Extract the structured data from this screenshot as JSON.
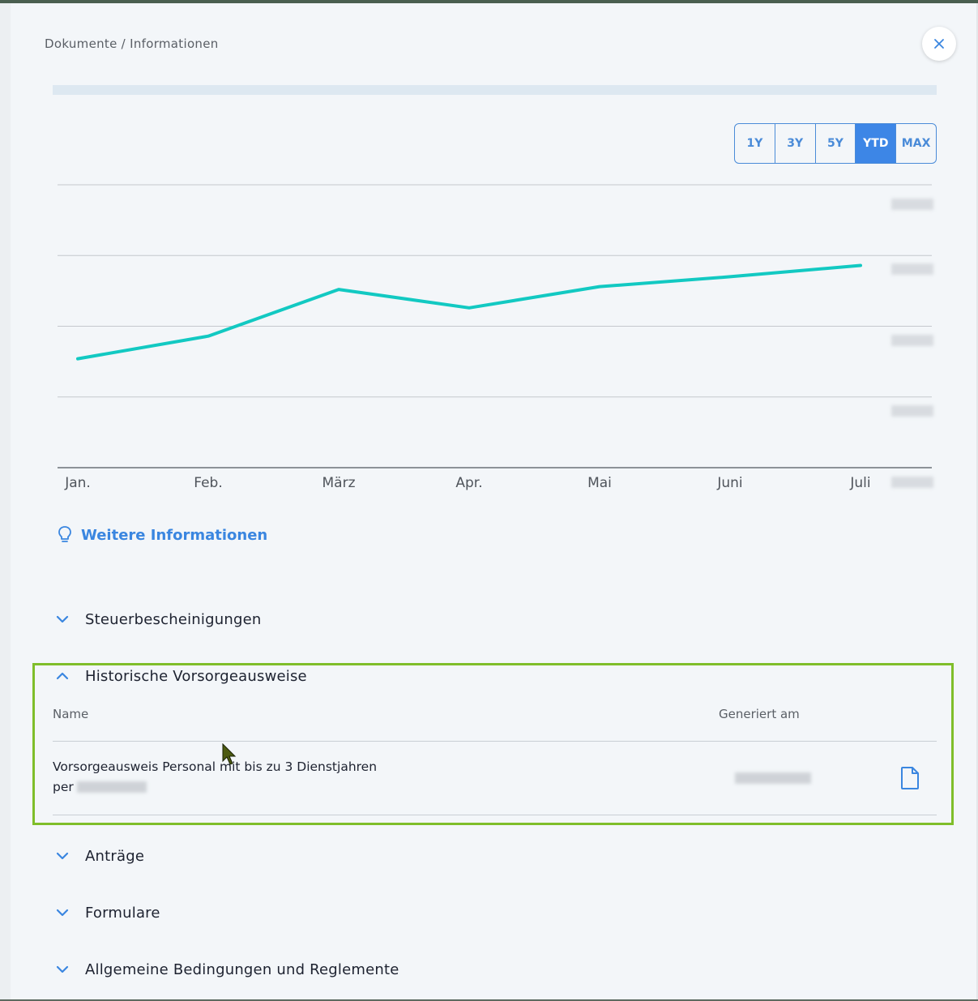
{
  "breadcrumb": "Dokumente / Informationen",
  "colors": {
    "accent": "#3d86e6",
    "line": "#12c9c2",
    "highlight": "#7fbe2a"
  },
  "range_buttons": [
    {
      "label": "1Y",
      "active": false
    },
    {
      "label": "3Y",
      "active": false
    },
    {
      "label": "5Y",
      "active": false
    },
    {
      "label": "YTD",
      "active": true
    },
    {
      "label": "MAX",
      "active": false
    }
  ],
  "chart_data": {
    "type": "line",
    "categories": [
      "Jan.",
      "Feb.",
      "März",
      "Apr.",
      "Mai",
      "Juni",
      "Juli"
    ],
    "series": [
      {
        "values": [
          102.7,
          104.3,
          107.6,
          106.3,
          107.8,
          108.5,
          109.3
        ]
      }
    ],
    "ylim": [
      95,
      115
    ],
    "y_tick_count": 5,
    "y_tick_labels_blurred": true,
    "grid": true
  },
  "more_info_label": "Weitere Informationen",
  "sections": {
    "steuer": "Steuerbescheinigungen",
    "historische": "Historische Vorsorgeausweise",
    "antraege": "Anträge",
    "formulare": "Formulare",
    "allgemeine": "Allgemeine Bedingungen und Reglemente"
  },
  "table": {
    "col_name": "Name",
    "col_generated": "Generiert am",
    "row": {
      "name": "Vorsorgeausweis Personal mit bis zu 3 Dienstjahren",
      "per_prefix": "per"
    }
  },
  "icons": {
    "close": "close-icon",
    "info": "lightbulb-icon",
    "expand": "chevron-down-icon",
    "collapse": "chevron-up-icon",
    "document": "document-icon"
  }
}
